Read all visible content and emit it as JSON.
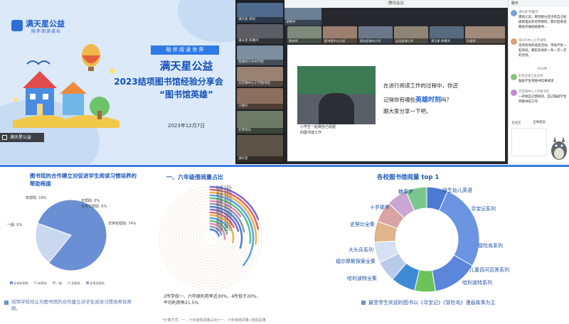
{
  "slide": {
    "logo": "满天星公益",
    "logo_sub": "陪伴阅读成长",
    "banner": "陪 伴 阅 读 世 界",
    "title1": "满天星公益",
    "title2": "2023结项图书馆经验分享会",
    "title3": "“图书馆英雄”",
    "date": "2023年12月7日",
    "share_label": "满天星公益",
    "colors": {
      "accent": "#1450b8",
      "banner": "#2f7ae8",
      "bg": "#dbe9f8"
    }
  },
  "gallery": {
    "tiles": [
      "满天星-郭凤",
      "满天星-陈曦鸿",
      "恰塘村小乡村学校",
      "天堂镇中心小学图书馆",
      "小鹅仔",
      "云贵阳光",
      "满天星"
    ]
  },
  "meeting": {
    "window_title": "腾讯会议",
    "tiles": [
      "黄老师",
      "图书馆中心小学",
      "德钦县城州小学",
      "云龙县城小学",
      "满天星-陈曦鸿",
      "冯老师",
      "满天星-广州"
    ],
    "cam_labels": [
      "录制中"
    ],
    "slide_question": [
      "在进行阅读工作的过程中，你还",
      "记得你有哪些",
      "英雄时刻",
      "吗？",
      "跟大家分享一下吧。"
    ],
    "photo_caption": [
      "小学生一起做自己组建",
      "的图书馆工作"
    ],
    "bottom_labels": [
      "满天星-陈曦鸿",
      "天堂镇中心小学图书馆"
    ]
  },
  "chat": {
    "header": "聊天",
    "messages": [
      {
        "name": "满天星-陈曦鸿",
        "text": "建组之前，看到部分还没有自己班级管理员的老师想的，我们后来说都会开展班级图书..."
      },
      {
        "name": "崇州市中心小学梁明",
        "text": "坚持有效的阅读活动、带动学生一起阅读，哪些有效的一条一次一次的坚持。"
      },
      {
        "name": "20分钟",
        "text": ""
      },
      {
        "name": "彩色金溪江生态林",
        "text": "鼓励学生到图书馆来阅读"
      },
      {
        "name": "天堂镇中心小学图书馆",
        "text": "一开始自己借阅读，自己鼓励学生到图书馆工作"
      }
    ],
    "input_label": "发送至",
    "input_select": "全体成员"
  },
  "pie": {
    "title": "图书馆的合作建立对促进学生阅读习惯培养的帮助程度",
    "labels": [
      {
        "text": "有帮助:  18%"
      },
      {
        "text": "无帮助:  0%"
      },
      {
        "text": "非常无帮助:  0%"
      },
      {
        "text": "一般:  0%"
      },
      {
        "text": "非常有帮助:  74%"
      }
    ],
    "legend": [
      "非常有帮助",
      "有帮助",
      "一般",
      "无帮助",
      "非常无帮助"
    ],
    "footnote": "结项学校均认为图书馆的合作建立对学生阅读习惯培养有帮助。"
  },
  "radial": {
    "title": "一、六年级借阅量占比",
    "labels": [
      "北岸 19%",
      "镇会 22%",
      "永乐 27%",
      "青苑 36%",
      "中村 27%",
      "顺路 15%",
      "城东 22%",
      "东升 30%",
      "都会 21%",
      "南桥 18%",
      "中心 28%",
      "昌平 16%",
      "西街 21%",
      "城西 26%",
      "六坝 20%",
      "东城 21%"
    ],
    "note": "2所学校一、六年级利用率近30%，4所低于20%，平均利用率21.5%",
    "calc": "*计算方式：一、六年级借阅量占比=一、六年级借阅量÷借阅总量"
  },
  "donut": {
    "title": "各校图书借阅量 top 1",
    "labels": [
      "糖果梦",
      "培生幼儿英语",
      "十岁那年",
      "寻宝记系列",
      "史努比全集",
      "冒险岛系列",
      "大头兵系列",
      "儿童百问百答系列",
      "福尔摩斯探案全集",
      "哈利波特全集",
      "哈利波特系列"
    ],
    "footnote": "最受学生欢迎的图书以《寻宝记》《冒险岛》漫画故事为主"
  },
  "chart_data": [
    {
      "type": "pie",
      "title": "图书馆的合作建立对促进学生阅读习惯培养的帮助程度",
      "categories": [
        "非常有帮助",
        "有帮助",
        "一般",
        "无帮助",
        "非常无帮助"
      ],
      "values": [
        74,
        18,
        0,
        0,
        0
      ],
      "colors": [
        "#6b8fd4",
        "#c9d7ef",
        "#b8bec8",
        "#d8d8d8",
        "#9aa8c0"
      ]
    },
    {
      "type": "bar",
      "title": "一、六年级借阅量占比",
      "categories": [
        "北岸",
        "镇会",
        "永乐",
        "青苑",
        "中村",
        "顺路",
        "城东",
        "东升",
        "都会",
        "南桥",
        "中心",
        "昌平",
        "西街",
        "城西",
        "六坝",
        "东城"
      ],
      "values": [
        19,
        22,
        27,
        36,
        27,
        15,
        22,
        30,
        21,
        18,
        28,
        16,
        21,
        26,
        20,
        21
      ],
      "ylim": [
        0,
        100
      ]
    },
    {
      "type": "pie",
      "title": "各校图书借阅量 top 1",
      "categories": [
        "培生幼儿英语",
        "寻宝记系列",
        "冒险岛系列",
        "儿童百问百答系列",
        "哈利波特系列",
        "哈利波特全集",
        "福尔摩斯探案全集",
        "大头兵系列",
        "史努比全集",
        "十岁那年",
        "糖果梦"
      ],
      "values": [
        6,
        25,
        13,
        6,
        7,
        6,
        6,
        6,
        6,
        6,
        6
      ],
      "colors": [
        "#4a7ad4",
        "#6a93e2",
        "#5c86dc",
        "#6ec25a",
        "#3f8ad7",
        "#b9cbea",
        "#d5e0f2",
        "#e0b48d",
        "#d9a4a4",
        "#caa6d5",
        "#7ac88d"
      ]
    }
  ]
}
